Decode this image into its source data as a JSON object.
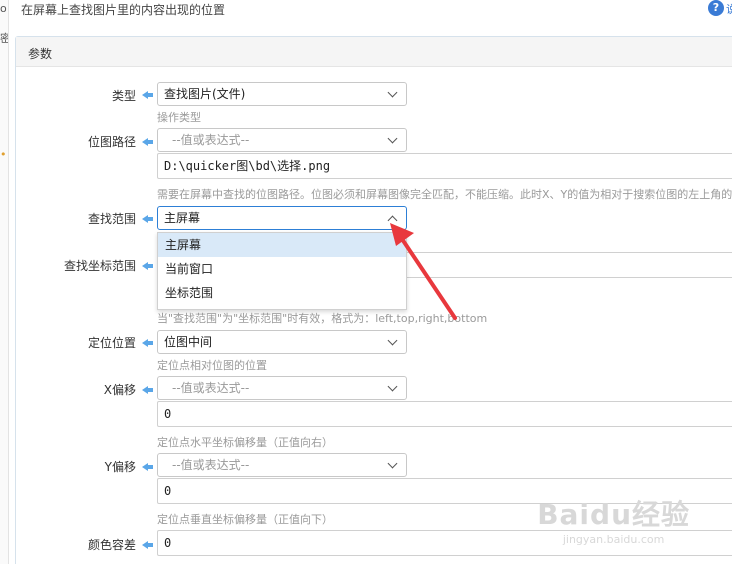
{
  "window": {
    "title": "在屏幕上查找图片里的内容出现的位置"
  },
  "panel": {
    "title": "参数"
  },
  "fields": {
    "type": {
      "label": "类型",
      "value": "查找图片(文件)",
      "hint": "操作类型"
    },
    "path": {
      "label": "位图路径",
      "placeholder": "--值或表达式--",
      "value": "D:\\quicker图\\bd\\选择.png",
      "hint": "需要在屏幕中查找的位图路径。位图必须和屏幕图像完全匹配，不能压缩。此时X、Y的值为相对于搜索位图的左上角的"
    },
    "scope": {
      "label": "查找范围",
      "value": "主屏幕",
      "options": [
        "主屏幕",
        "当前窗口",
        "坐标范围"
      ],
      "selected_index": 0
    },
    "coord_range": {
      "label": "查找坐标范围",
      "hint": "当\"查找范围\"为\"坐标范围\"时有效，格式为：left,top,right,bottom"
    },
    "anchor": {
      "label": "定位位置",
      "value": "位图中间",
      "hint": "定位点相对位图的位置"
    },
    "x_offset": {
      "label": "X偏移",
      "placeholder": "--值或表达式--",
      "value": "0",
      "hint": "定位点水平坐标偏移量（正值向右）"
    },
    "y_offset": {
      "label": "Y偏移",
      "placeholder": "--值或表达式--",
      "value": "0",
      "hint": "定位点垂直坐标偏移量（正值向下）"
    },
    "tolerance": {
      "label": "颜色容差",
      "value": "0"
    }
  },
  "icons": {
    "help": "help-circle-icon",
    "label_arrow": "arrow-left-icon"
  },
  "colors": {
    "accent": "#2d7fd6",
    "annotation": "#e8383d",
    "selected_option": "#d9e9f8"
  },
  "watermark": {
    "main": "Baidu经验",
    "sub": "jingyan.baidu.com"
  }
}
